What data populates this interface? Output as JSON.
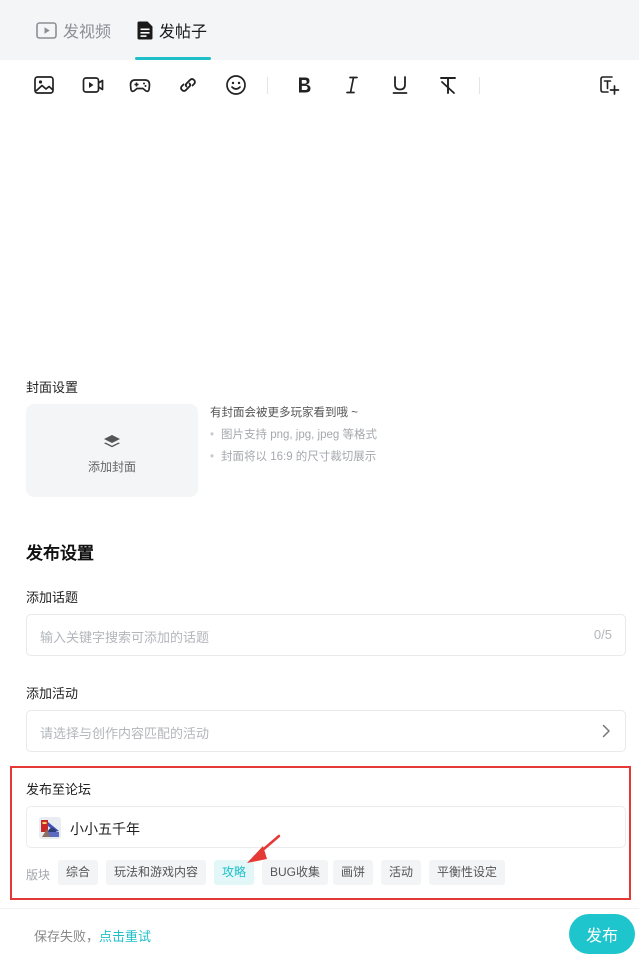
{
  "tabs": {
    "video_label": "发视频",
    "post_label": "发帖子"
  },
  "toolbar": {
    "icons": [
      "image-icon",
      "video-icon",
      "gamepad-icon",
      "link-icon",
      "emoji-icon",
      "bold-icon",
      "italic-icon",
      "underline-icon",
      "clear-format-icon",
      "text-add-icon"
    ]
  },
  "cover": {
    "label": "封面设置",
    "add_label": "添加封面",
    "tip_title": "有封面会被更多玩家看到哦 ~",
    "tip_formats": "图片支持 png, jpg, jpeg 等格式",
    "tip_crop": "封面将以 16:9 的尺寸裁切展示"
  },
  "publish_settings": {
    "title": "发布设置",
    "topic_label": "添加话题",
    "topic_placeholder": "输入关键字搜索可添加的话题",
    "topic_count": "0/5",
    "activity_label": "添加活动",
    "activity_placeholder": "请选择与创作内容匹配的活动"
  },
  "forum": {
    "label": "发布至论坛",
    "game_name": "小小五千年",
    "section_label": "版块",
    "sections": [
      "综合",
      "玩法和游戏内容",
      "攻略",
      "BUG收集",
      "画饼",
      "活动",
      "平衡性设定"
    ],
    "selected_section": "攻略"
  },
  "footer": {
    "status_text": "保存失败，",
    "retry_label": "点击重试",
    "publish_label": "发布"
  },
  "colors": {
    "accent": "#1fbfc9",
    "highlight_border": "#e53935",
    "annotation_arrow": "#e53935"
  }
}
